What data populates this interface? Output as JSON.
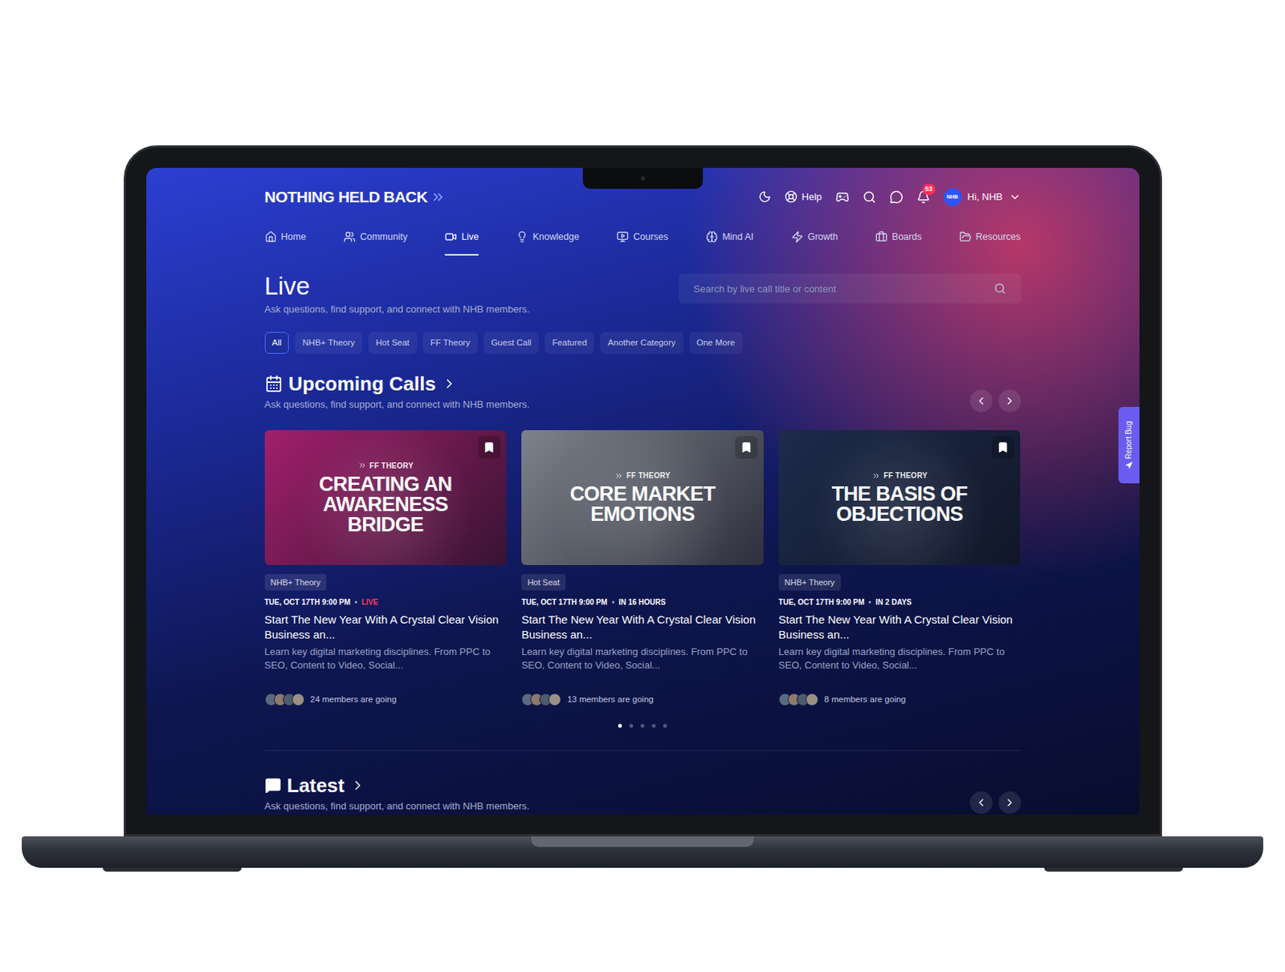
{
  "header": {
    "logo": "NOTHING HELD BACK",
    "help": "Help",
    "notifications": "53",
    "avatar": "NHB",
    "greeting": "Hi, NHB"
  },
  "nav": [
    {
      "label": "Home",
      "selected": false
    },
    {
      "label": "Community",
      "selected": false
    },
    {
      "label": "Live",
      "selected": true
    },
    {
      "label": "Knowledge",
      "selected": false
    },
    {
      "label": "Courses",
      "selected": false
    },
    {
      "label": "Mind AI",
      "selected": false
    },
    {
      "label": "Growth",
      "selected": false
    },
    {
      "label": "Boards",
      "selected": false
    },
    {
      "label": "Resources",
      "selected": false
    }
  ],
  "page": {
    "title": "Live",
    "subtitle": "Ask questions, find support, and connect with NHB members."
  },
  "search": {
    "placeholder": "Search by live call title or content"
  },
  "filters": [
    {
      "label": "All",
      "selected": true
    },
    {
      "label": "NHB+ Theory",
      "selected": false
    },
    {
      "label": "Hot Seat",
      "selected": false
    },
    {
      "label": "FF Theory",
      "selected": false
    },
    {
      "label": "Guest Call",
      "selected": false
    },
    {
      "label": "Featured",
      "selected": false
    },
    {
      "label": "Another Category",
      "selected": false
    },
    {
      "label": "One More",
      "selected": false
    }
  ],
  "upcoming": {
    "title": "Upcoming Calls",
    "subtitle": "Ask questions, find support, and connect with NHB members.",
    "cards": [
      {
        "thumbnail": {
          "eyebrow": "FF THEORY",
          "title": "CREATING AN AWARENESS BRIDGE",
          "color": "#a11f6b"
        },
        "bookmarked": true,
        "category": "NHB+ Theory",
        "date": "TUE, OCT 17TH 9:00 PM",
        "status": "LIVE",
        "live": true,
        "title": "Start The New Year With A Crystal Clear Vision Business an...",
        "description": "Learn key digital marketing disciplines. From PPC to SEO, Content to Video, Social...",
        "avatars": 4,
        "members": "24 members are going"
      },
      {
        "thumbnail": {
          "eyebrow": "FF THEORY",
          "title": "CORE MARKET EMOTIONS",
          "color": "#7d828c"
        },
        "bookmarked": true,
        "category": "Hot Seat",
        "date": "TUE, OCT 17TH 9:00 PM",
        "status": "IN 16 HOURS",
        "live": false,
        "title": "Start The New Year With A Crystal Clear Vision Business an...",
        "description": "Learn key digital marketing disciplines. From PPC to SEO, Content to Video, Social...",
        "avatars": 4,
        "members": "13 members are going"
      },
      {
        "thumbnail": {
          "eyebrow": "FF THEORY",
          "title": "THE BASIS OF OBJECTIONS",
          "color": "#1d2b4a"
        },
        "bookmarked": true,
        "category": "NHB+ Theory",
        "date": "TUE, OCT 17TH 9:00 PM",
        "status": "IN 2 DAYS",
        "live": false,
        "title": "Start The New Year With A Crystal Clear Vision Business an...",
        "description": "Learn key digital marketing disciplines. From PPC to SEO, Content to Video, Social...",
        "avatars": 4,
        "members": "8 members are going"
      }
    ],
    "pages": [
      {
        "selected": true
      },
      {
        "selected": false
      },
      {
        "selected": false
      },
      {
        "selected": false
      },
      {
        "selected": false
      }
    ]
  },
  "latest": {
    "title": "Latest",
    "subtitle": "Ask questions, find support, and connect with NHB members."
  },
  "report_bug": "Report Bug"
}
